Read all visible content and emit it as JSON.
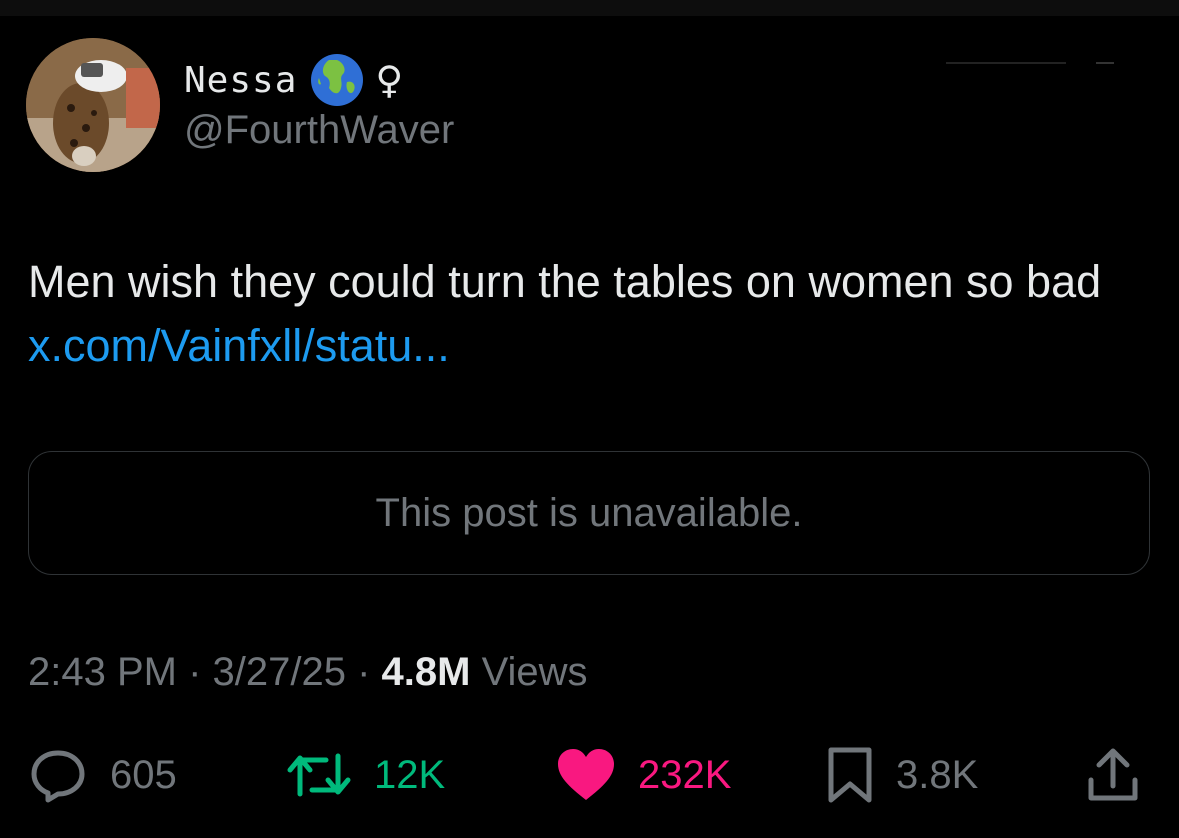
{
  "author": {
    "display_name": "Nessa",
    "badge_icon": "globe-emoji-icon",
    "symbol": "♀",
    "handle": "@FourthWaver"
  },
  "tweet": {
    "text": "Men wish they could turn the tables on women so bad ",
    "link_text": "x.com/Vainfxll/statu..."
  },
  "quoted_post": {
    "message": "This post is unavailable."
  },
  "meta": {
    "time": "2:43 PM",
    "separator1": " · ",
    "date": "3/27/25",
    "separator2": " · ",
    "views_count": "4.8M",
    "views_label": " Views"
  },
  "actions": {
    "replies": "605",
    "reposts": "12K",
    "likes": "232K",
    "bookmarks": "3.8K"
  },
  "colors": {
    "background": "#000000",
    "text": "#e7e9ea",
    "secondary": "#71767b",
    "link": "#1d9bf0",
    "repost": "#00ba7c",
    "like": "#f91880"
  }
}
